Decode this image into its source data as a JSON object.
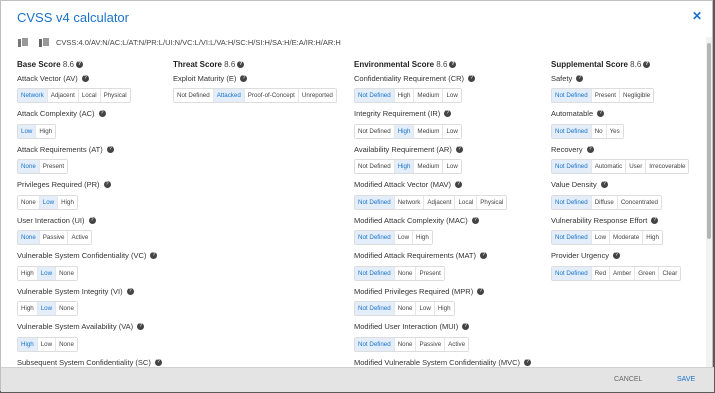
{
  "title": "CVSS v4 calculator",
  "vector": "CVSS:4.0/AV:N/AC:L/AT:N/PR:L/UI:N/VC:L/VI:L/VA:H/SC:H/SI:H/SA:H/E:A/IR:H/AR:H",
  "close_label": "✕",
  "footer": {
    "cancel": "CANCEL",
    "save": "SAVE"
  },
  "columns": [
    {
      "name": "Base Score",
      "score": "8.6",
      "metrics": [
        {
          "label": "Attack Vector (AV)",
          "options": [
            "Network",
            "Adjacent",
            "Local",
            "Physical"
          ],
          "selected": 0
        },
        {
          "label": "Attack Complexity (AC)",
          "options": [
            "Low",
            "High"
          ],
          "selected": 0
        },
        {
          "label": "Attack Requirements (AT)",
          "options": [
            "None",
            "Present"
          ],
          "selected": 0
        },
        {
          "label": "Privileges Required (PR)",
          "options": [
            "None",
            "Low",
            "High"
          ],
          "selected": 1
        },
        {
          "label": "User Interaction (UI)",
          "options": [
            "None",
            "Passive",
            "Active"
          ],
          "selected": 0
        },
        {
          "label": "Vulnerable System Confidentiality (VC)",
          "options": [
            "High",
            "Low",
            "None"
          ],
          "selected": 1
        },
        {
          "label": "Vulnerable System Integrity (VI)",
          "options": [
            "High",
            "Low",
            "None"
          ],
          "selected": 1
        },
        {
          "label": "Vulnerable System Availability (VA)",
          "options": [
            "High",
            "Low",
            "None"
          ],
          "selected": 0
        },
        {
          "label": "Subsequent System Confidentiality (SC)",
          "options": [],
          "selected": -1
        }
      ]
    },
    {
      "name": "Threat Score",
      "score": "8.6",
      "metrics": [
        {
          "label": "Exploit Maturity (E)",
          "options": [
            "Not Defined",
            "Attacked",
            "Proof-of-Concept",
            "Unreported"
          ],
          "selected": 1
        }
      ]
    },
    {
      "name": "Environmental Score",
      "score": "8.6",
      "metrics": [
        {
          "label": "Confidentiality Requirement (CR)",
          "options": [
            "Not Defined",
            "High",
            "Medium",
            "Low"
          ],
          "selected": 0
        },
        {
          "label": "Integrity Requirement (IR)",
          "options": [
            "Not Defined",
            "High",
            "Medium",
            "Low"
          ],
          "selected": 1
        },
        {
          "label": "Availability Requirement (AR)",
          "options": [
            "Not Defined",
            "High",
            "Medium",
            "Low"
          ],
          "selected": 1
        },
        {
          "label": "Modified Attack Vector (MAV)",
          "options": [
            "Not Defined",
            "Network",
            "Adjacent",
            "Local",
            "Physical"
          ],
          "selected": 0
        },
        {
          "label": "Modified Attack Complexity (MAC)",
          "options": [
            "Not Defined",
            "Low",
            "High"
          ],
          "selected": 0
        },
        {
          "label": "Modified Attack Requirements (MAT)",
          "options": [
            "Not Defined",
            "None",
            "Present"
          ],
          "selected": 0
        },
        {
          "label": "Modified Privileges Required (MPR)",
          "options": [
            "Not Defined",
            "None",
            "Low",
            "High"
          ],
          "selected": 0
        },
        {
          "label": "Modified User Interaction (MUI)",
          "options": [
            "Not Defined",
            "None",
            "Passive",
            "Active"
          ],
          "selected": 0
        },
        {
          "label": "Modified Vulnerable System Confidentiality (MVC)",
          "options": [],
          "selected": -1
        }
      ]
    },
    {
      "name": "Supplemental Score",
      "score": "8.6",
      "metrics": [
        {
          "label": "Safety",
          "options": [
            "Not Defined",
            "Present",
            "Negligible"
          ],
          "selected": 0
        },
        {
          "label": "Automatable",
          "options": [
            "Not Defined",
            "No",
            "Yes"
          ],
          "selected": 0
        },
        {
          "label": "Recovery",
          "options": [
            "Not Defined",
            "Automatic",
            "User",
            "Irrecoverable"
          ],
          "selected": 0
        },
        {
          "label": "Value Density",
          "options": [
            "Not Defined",
            "Diffuse",
            "Concentrated"
          ],
          "selected": 0
        },
        {
          "label": "Vulnerability Response Effort",
          "options": [
            "Not Defined",
            "Low",
            "Moderate",
            "High"
          ],
          "selected": 0
        },
        {
          "label": "Provider Urgency",
          "options": [
            "Not Defined",
            "Red",
            "Amber",
            "Green",
            "Clear"
          ],
          "selected": 0
        }
      ]
    }
  ]
}
